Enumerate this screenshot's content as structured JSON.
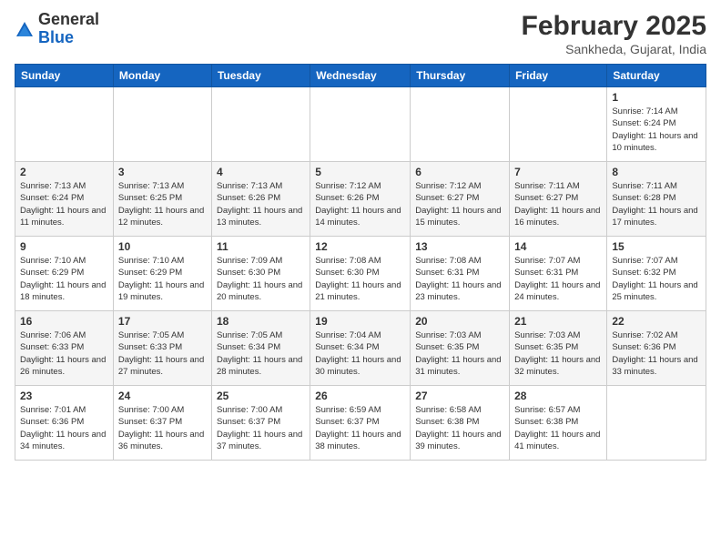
{
  "header": {
    "logo_general": "General",
    "logo_blue": "Blue",
    "month_title": "February 2025",
    "location": "Sankheda, Gujarat, India"
  },
  "days_of_week": [
    "Sunday",
    "Monday",
    "Tuesday",
    "Wednesday",
    "Thursday",
    "Friday",
    "Saturday"
  ],
  "weeks": [
    [
      {
        "day": "",
        "info": ""
      },
      {
        "day": "",
        "info": ""
      },
      {
        "day": "",
        "info": ""
      },
      {
        "day": "",
        "info": ""
      },
      {
        "day": "",
        "info": ""
      },
      {
        "day": "",
        "info": ""
      },
      {
        "day": "1",
        "info": "Sunrise: 7:14 AM\nSunset: 6:24 PM\nDaylight: 11 hours\nand 10 minutes."
      }
    ],
    [
      {
        "day": "2",
        "info": "Sunrise: 7:13 AM\nSunset: 6:24 PM\nDaylight: 11 hours\nand 11 minutes."
      },
      {
        "day": "3",
        "info": "Sunrise: 7:13 AM\nSunset: 6:25 PM\nDaylight: 11 hours\nand 12 minutes."
      },
      {
        "day": "4",
        "info": "Sunrise: 7:13 AM\nSunset: 6:26 PM\nDaylight: 11 hours\nand 13 minutes."
      },
      {
        "day": "5",
        "info": "Sunrise: 7:12 AM\nSunset: 6:26 PM\nDaylight: 11 hours\nand 14 minutes."
      },
      {
        "day": "6",
        "info": "Sunrise: 7:12 AM\nSunset: 6:27 PM\nDaylight: 11 hours\nand 15 minutes."
      },
      {
        "day": "7",
        "info": "Sunrise: 7:11 AM\nSunset: 6:27 PM\nDaylight: 11 hours\nand 16 minutes."
      },
      {
        "day": "8",
        "info": "Sunrise: 7:11 AM\nSunset: 6:28 PM\nDaylight: 11 hours\nand 17 minutes."
      }
    ],
    [
      {
        "day": "9",
        "info": "Sunrise: 7:10 AM\nSunset: 6:29 PM\nDaylight: 11 hours\nand 18 minutes."
      },
      {
        "day": "10",
        "info": "Sunrise: 7:10 AM\nSunset: 6:29 PM\nDaylight: 11 hours\nand 19 minutes."
      },
      {
        "day": "11",
        "info": "Sunrise: 7:09 AM\nSunset: 6:30 PM\nDaylight: 11 hours\nand 20 minutes."
      },
      {
        "day": "12",
        "info": "Sunrise: 7:08 AM\nSunset: 6:30 PM\nDaylight: 11 hours\nand 21 minutes."
      },
      {
        "day": "13",
        "info": "Sunrise: 7:08 AM\nSunset: 6:31 PM\nDaylight: 11 hours\nand 23 minutes."
      },
      {
        "day": "14",
        "info": "Sunrise: 7:07 AM\nSunset: 6:31 PM\nDaylight: 11 hours\nand 24 minutes."
      },
      {
        "day": "15",
        "info": "Sunrise: 7:07 AM\nSunset: 6:32 PM\nDaylight: 11 hours\nand 25 minutes."
      }
    ],
    [
      {
        "day": "16",
        "info": "Sunrise: 7:06 AM\nSunset: 6:33 PM\nDaylight: 11 hours\nand 26 minutes."
      },
      {
        "day": "17",
        "info": "Sunrise: 7:05 AM\nSunset: 6:33 PM\nDaylight: 11 hours\nand 27 minutes."
      },
      {
        "day": "18",
        "info": "Sunrise: 7:05 AM\nSunset: 6:34 PM\nDaylight: 11 hours\nand 28 minutes."
      },
      {
        "day": "19",
        "info": "Sunrise: 7:04 AM\nSunset: 6:34 PM\nDaylight: 11 hours\nand 30 minutes."
      },
      {
        "day": "20",
        "info": "Sunrise: 7:03 AM\nSunset: 6:35 PM\nDaylight: 11 hours\nand 31 minutes."
      },
      {
        "day": "21",
        "info": "Sunrise: 7:03 AM\nSunset: 6:35 PM\nDaylight: 11 hours\nand 32 minutes."
      },
      {
        "day": "22",
        "info": "Sunrise: 7:02 AM\nSunset: 6:36 PM\nDaylight: 11 hours\nand 33 minutes."
      }
    ],
    [
      {
        "day": "23",
        "info": "Sunrise: 7:01 AM\nSunset: 6:36 PM\nDaylight: 11 hours\nand 34 minutes."
      },
      {
        "day": "24",
        "info": "Sunrise: 7:00 AM\nSunset: 6:37 PM\nDaylight: 11 hours\nand 36 minutes."
      },
      {
        "day": "25",
        "info": "Sunrise: 7:00 AM\nSunset: 6:37 PM\nDaylight: 11 hours\nand 37 minutes."
      },
      {
        "day": "26",
        "info": "Sunrise: 6:59 AM\nSunset: 6:37 PM\nDaylight: 11 hours\nand 38 minutes."
      },
      {
        "day": "27",
        "info": "Sunrise: 6:58 AM\nSunset: 6:38 PM\nDaylight: 11 hours\nand 39 minutes."
      },
      {
        "day": "28",
        "info": "Sunrise: 6:57 AM\nSunset: 6:38 PM\nDaylight: 11 hours\nand 41 minutes."
      },
      {
        "day": "",
        "info": ""
      }
    ]
  ]
}
